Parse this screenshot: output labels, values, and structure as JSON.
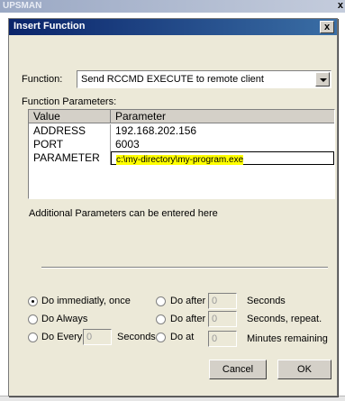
{
  "background_window": {
    "title": "UPSMAN",
    "close_glyph": "x"
  },
  "dialog": {
    "title": "Insert Function",
    "close_glyph": "x"
  },
  "function": {
    "label": "Function:",
    "selected": "Send RCCMD EXECUTE to remote client"
  },
  "parameters": {
    "label": "Function Parameters:",
    "columns": [
      "Value",
      "Parameter"
    ],
    "rows": [
      {
        "value": "ADDRESS",
        "parameter": "192.168.202.156"
      },
      {
        "value": "PORT",
        "parameter": "6003"
      },
      {
        "value": "PARAMETER",
        "parameter": "c:\\my-directory\\my-program.exe"
      }
    ],
    "highlight_color": "#ffff00"
  },
  "additional_note": "Additional Parameters can be entered here",
  "schedule": {
    "do_immediately": "Do immediatly, once",
    "do_always": "Do Always",
    "do_every": "Do Every",
    "do_every_value": "0",
    "do_every_unit": "Seconds",
    "do_after_1": "Do after",
    "do_after_1_value": "0",
    "do_after_1_unit": "Seconds",
    "do_after_2": "Do after",
    "do_after_2_value": "0",
    "do_after_2_unit": "Seconds, repeat.",
    "do_at": "Do at",
    "do_at_value": "0",
    "do_at_unit": "Minutes remaining",
    "selected": "do_immediately"
  },
  "buttons": {
    "cancel": "Cancel",
    "ok": "OK"
  },
  "colors": {
    "title_bar": "#0a246a",
    "dialog_bg": "#ece9d8"
  }
}
